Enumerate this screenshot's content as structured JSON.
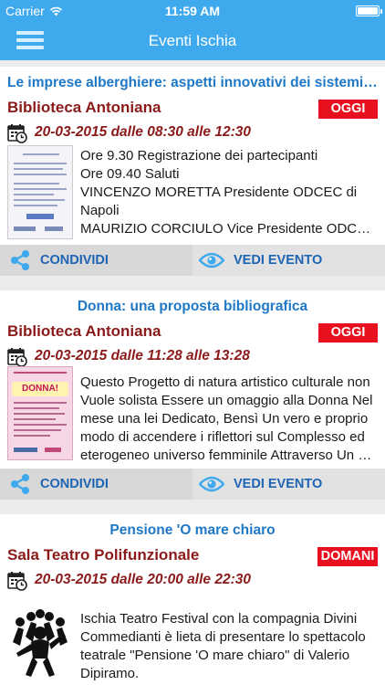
{
  "status": {
    "carrier": "Carrier",
    "time": "11:59 AM"
  },
  "nav": {
    "title": "Eventi Ischia"
  },
  "events": [
    {
      "title": "Le imprese alberghiere: aspetti innovativi dei sistemi di controll…",
      "venue": "Biblioteca Antoniana",
      "badge": "OGGI",
      "date": "20-03-2015 dalle 08:30 alle 12:30",
      "lines": [
        "Ore 9.30 Registrazione dei partecipanti",
        "Ore 09.40 Saluti",
        "VINCENZO MORETTA Presidente ODCEC di",
        "Napoli",
        "MAURIZIO CORCIULO Vice Presidente ODCEC…"
      ],
      "share_label": "CONDIVIDI",
      "view_label": "VEDI EVENTO"
    },
    {
      "title": "Donna: una proposta bibliografica",
      "venue": "Biblioteca Antoniana",
      "badge": "OGGI",
      "date": "20-03-2015 dalle 11:28 alle 13:28",
      "lines": [
        "Questo  Progetto di natura artistico culturale non",
        "Vuole solista Essere un omaggio alla Donna Nel",
        "mese una lei Dedicato, Bensì Un vero e proprio",
        "modo di accendere i riflettori sul Complesso ed",
        "eterogeneo universo femminile Attraverso Un vi…"
      ],
      "thumb_text": "DONNA!",
      "share_label": "CONDIVIDI",
      "view_label": "VEDI EVENTO"
    },
    {
      "title": "Pensione 'O mare chiaro",
      "venue": "Sala Teatro Polifunzionale",
      "badge": "DOMANI",
      "date": "20-03-2015 dalle 20:00 alle 22:30",
      "lines": [
        "Ischia Teatro Festival con la compagnia Divini",
        "Commedianti è lieta di presentare lo spettacolo",
        "teatrale \"Pensione 'O mare chiaro\" di Valerio",
        "Dipiramo."
      ]
    }
  ]
}
